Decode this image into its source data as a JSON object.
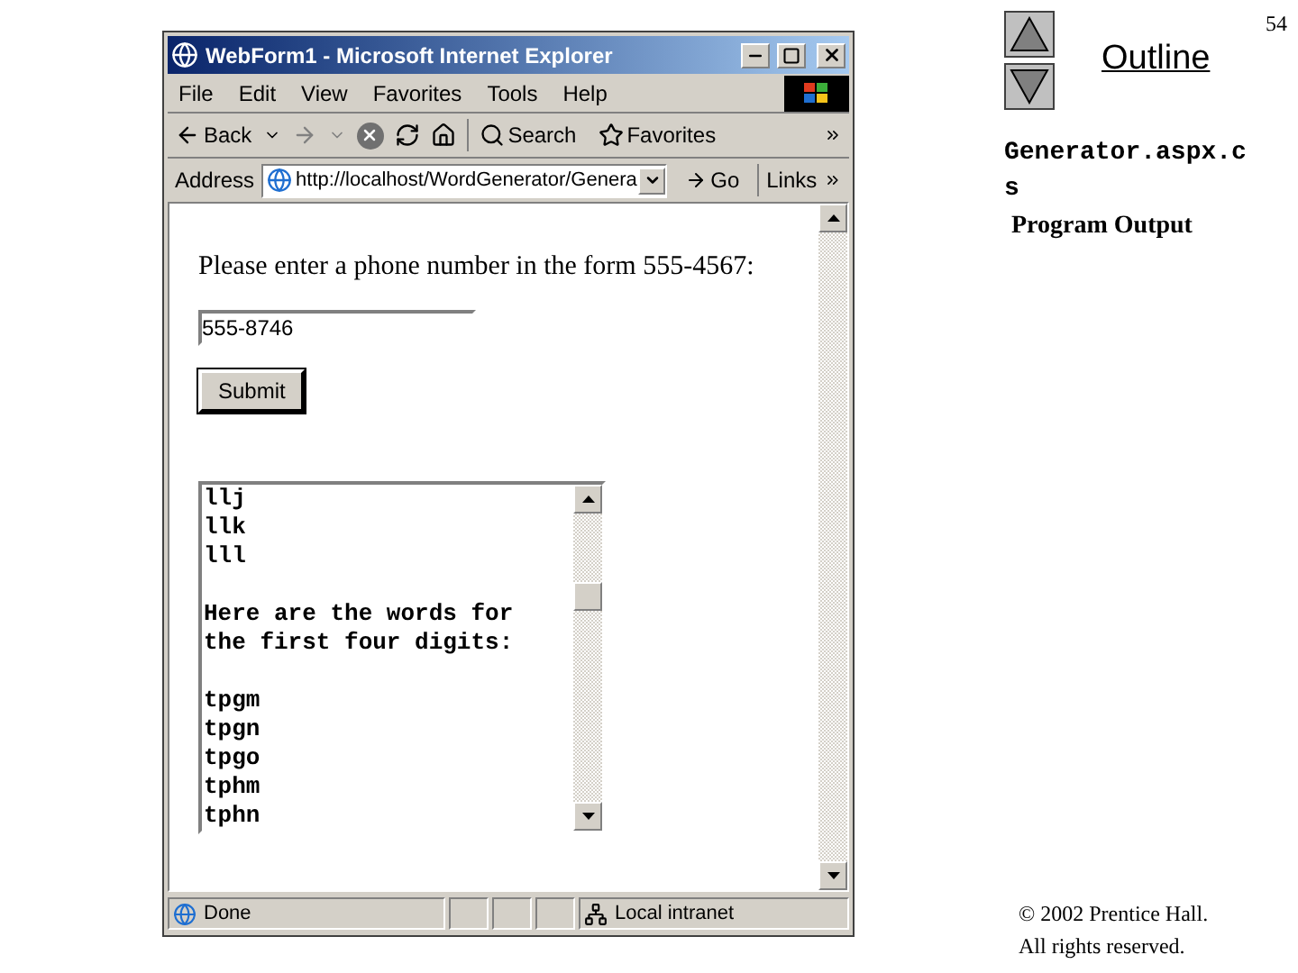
{
  "slide_number": "54",
  "outline": {
    "title": "Outline",
    "file": "Generator.aspx.cs",
    "caption": "Program Output"
  },
  "window": {
    "title": "WebForm1 - Microsoft Internet Explorer",
    "menu": [
      "File",
      "Edit",
      "View",
      "Favorites",
      "Tools",
      "Help"
    ],
    "toolbar": {
      "back": "Back",
      "search": "Search",
      "favorites": "Favorites"
    },
    "address": {
      "label": "Address",
      "value": "http://localhost/WordGenerator/Genera",
      "go": "Go",
      "links": "Links"
    },
    "page": {
      "prompt": "Please enter a phone number in the form 555-4567:",
      "phone": "555-8746",
      "submit": "Submit",
      "output_groups": [
        [
          "llj",
          "llk",
          "lll"
        ],
        [
          "Here are the words for the first four digits:"
        ],
        [
          "tpgm",
          "tpgn",
          "tpgo",
          "tphm",
          "tphn"
        ]
      ]
    },
    "status_bar": {
      "status": "Done",
      "zone": "Local intranet"
    }
  },
  "copyright": [
    "© 2002 Prentice Hall.",
    "All rights reserved."
  ]
}
